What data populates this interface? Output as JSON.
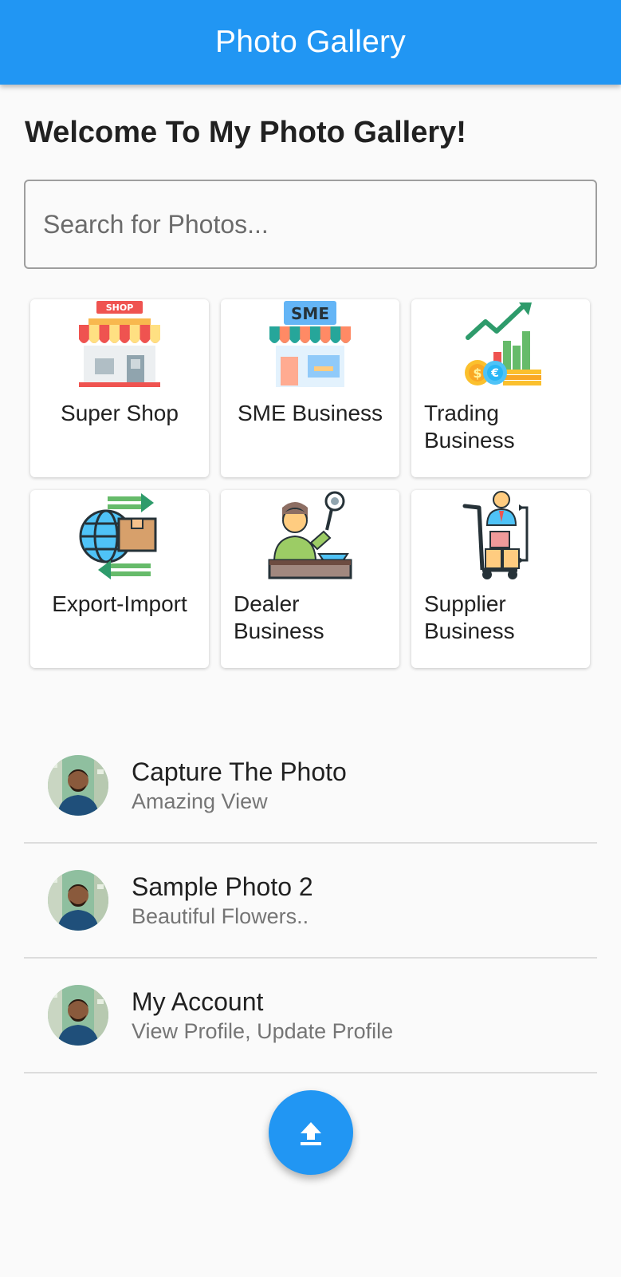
{
  "appbar": {
    "title": "Photo Gallery"
  },
  "welcome": "Welcome To My Photo Gallery!",
  "search": {
    "placeholder": "Search for Photos..."
  },
  "categories": [
    {
      "label": "Super Shop",
      "icon": "shop-icon"
    },
    {
      "label": "SME Business",
      "icon": "sme-store-icon"
    },
    {
      "label": "Trading Business",
      "icon": "trading-chart-icon"
    },
    {
      "label": "Export-Import",
      "icon": "export-import-icon"
    },
    {
      "label": "Dealer Business",
      "icon": "dealer-icon"
    },
    {
      "label": "Supplier Business",
      "icon": "supplier-icon"
    }
  ],
  "list": [
    {
      "title": "Capture The Photo",
      "subtitle": "Amazing View",
      "icon": "avatar"
    },
    {
      "title": "Sample Photo 2",
      "subtitle": "Beautiful Flowers..",
      "icon": "avatar"
    },
    {
      "title": "My Account",
      "subtitle": "View Profile, Update Profile",
      "icon": "avatar"
    }
  ],
  "fab": {
    "icon": "upload-icon"
  },
  "colors": {
    "primary": "#2196f3",
    "background": "#fafafa",
    "text": "#212121",
    "subtext": "#757575"
  }
}
